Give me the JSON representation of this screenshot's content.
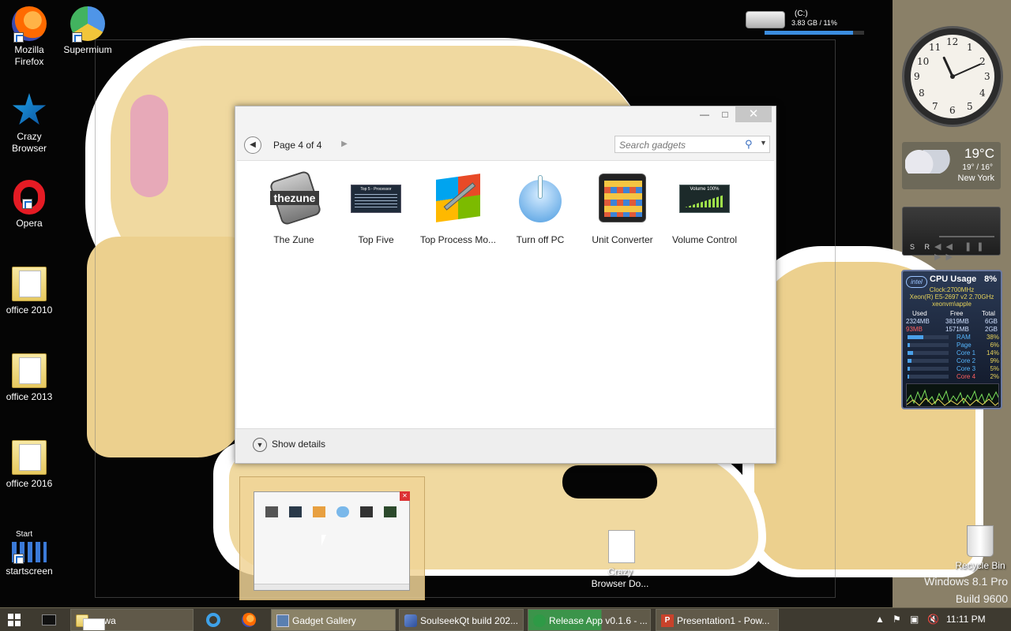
{
  "desktop_icons": [
    {
      "label_lines": [
        "Mozilla",
        "Firefox"
      ]
    },
    {
      "label_lines": [
        "Supermium"
      ]
    },
    {
      "label_lines": [
        "Crazy",
        "Browser"
      ]
    },
    {
      "label_lines": [
        "Opera"
      ]
    },
    {
      "label_lines": [
        "office 2010"
      ]
    },
    {
      "label_lines": [
        "office 2013"
      ]
    },
    {
      "label_lines": [
        "office 2016"
      ]
    },
    {
      "label_lines": [
        "startscreen"
      ],
      "caption": "Start"
    },
    {
      "label_lines": [
        "Crazy",
        "Browser Do..."
      ]
    },
    {
      "label_lines": [
        "Recycle Bin"
      ]
    }
  ],
  "gallery": {
    "page_label": "Page 4 of 4",
    "search_placeholder": "Search gadgets",
    "show_details_label": "Show details",
    "gadgets": [
      {
        "name": "The Zune",
        "thumb_text": "thezune"
      },
      {
        "name": "Top Five",
        "thumb_text": "Top 5 - Processor"
      },
      {
        "name": "Top Process Mo..."
      },
      {
        "name": "Turn off PC"
      },
      {
        "name": "Unit Converter"
      },
      {
        "name": "Volume Control",
        "thumb_text": "Volume 100%"
      }
    ]
  },
  "drive": {
    "name": "(C:)",
    "info": "3.83 GB / 11%",
    "used_fraction": 0.89
  },
  "clock": {
    "numbers": [
      "12",
      "1",
      "2",
      "3",
      "4",
      "5",
      "6",
      "7",
      "8",
      "9",
      "10",
      "11"
    ],
    "time": "11:11"
  },
  "weather": {
    "temp": "19°C",
    "range": "19° / 16°",
    "city": "New York"
  },
  "media": {
    "sr_label": "S R"
  },
  "cpu": {
    "title": "CPU Usage",
    "percent": "8%",
    "logo": "intel",
    "clock": "Clock:2700MHz",
    "model": "Xeon(R) E5-2697 v2 2.70GHz",
    "host": "xeonvm\\apple",
    "headers": [
      "Used",
      "Free",
      "Total"
    ],
    "ram_row": [
      "2324MB",
      "3819MB",
      "6GB"
    ],
    "page_row": [
      "93MB",
      "1571MB",
      "2GB"
    ],
    "meters": [
      {
        "label": "RAM",
        "value": "38%",
        "fraction": 0.38
      },
      {
        "label": "Page",
        "value": "6%",
        "fraction": 0.06
      },
      {
        "label": "Core 1",
        "value": "14%",
        "fraction": 0.14
      },
      {
        "label": "Core 2",
        "value": "9%",
        "fraction": 0.09
      },
      {
        "label": "Core 3",
        "value": "5%",
        "fraction": 0.05
      },
      {
        "label": "Core 4",
        "value": "2%",
        "fraction": 0.02
      }
    ]
  },
  "watermark": {
    "line1": "Windows 8.1 Pro",
    "line2": "Build 9600"
  },
  "taskbar": {
    "tasks": [
      {
        "label": "wawa"
      },
      {
        "label": "Gadget Gallery"
      },
      {
        "label": "SoulseekQt build 202..."
      },
      {
        "label": "Release App v0.1.6 - ..."
      },
      {
        "label": "Presentation1 - Pow..."
      }
    ],
    "time": "11:11 PM"
  },
  "colors": {
    "wallpaper_fill": "#f0d9a0",
    "taskbar": "#3e3a30",
    "accent": "#3b8de0"
  }
}
